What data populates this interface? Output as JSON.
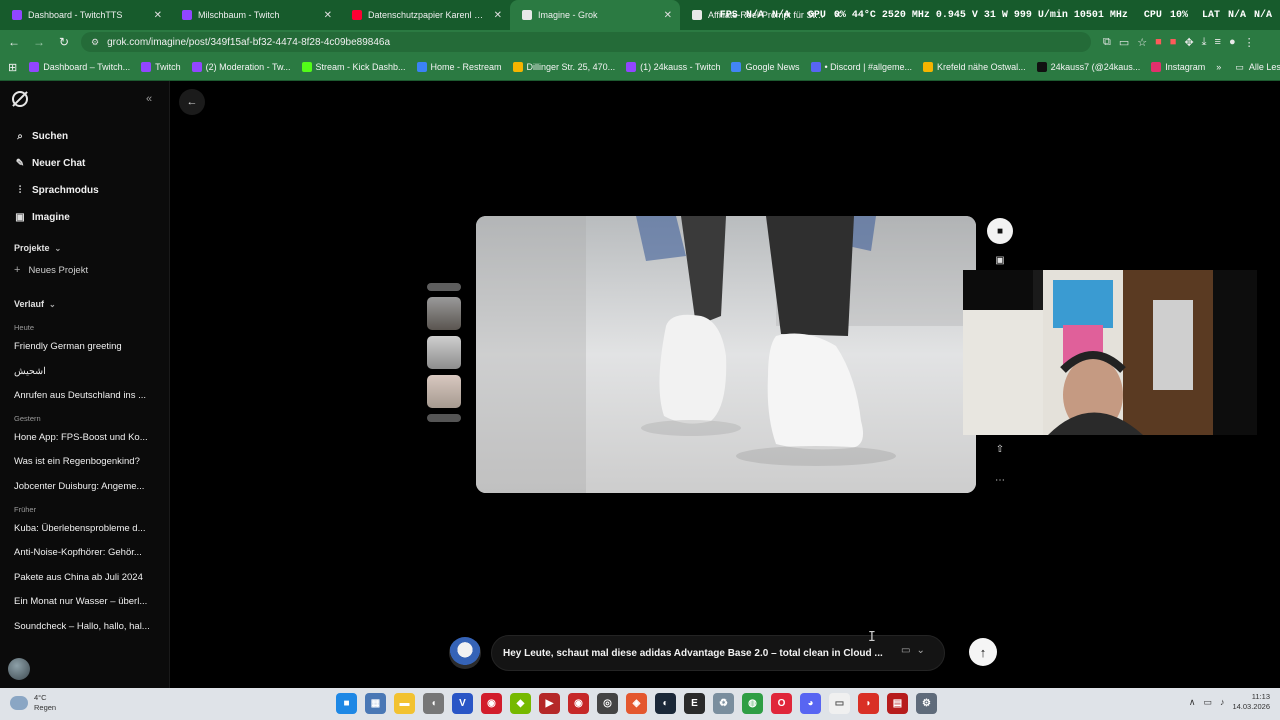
{
  "tabs": [
    {
      "label": "Dashboard - TwitchTTS",
      "color": "#9146ff",
      "active": false
    },
    {
      "label": "Milschbaum - Twitch",
      "color": "#9146ff",
      "active": false
    },
    {
      "label": "Datenschutzpapier Karenl Dein",
      "color": "#ff0033",
      "active": false
    },
    {
      "label": "Imagine - Grok",
      "color": "#e8e8e8",
      "active": true
    },
    {
      "label": "Affiliate-Reel-Prompt für Styling",
      "color": "#e8e8e8",
      "active": false
    }
  ],
  "hud": {
    "fps": "FPS",
    "fps_val": "N/A",
    "fps_val2": "N/A",
    "gpu": "GPU",
    "gpu_stats": "0% 44°C 2520 MHz 0.945 V 31 W 999 U/min 10501 MHz",
    "cpu": "CPU",
    "cpu_val": "10%",
    "lat": "LAT",
    "lat_val": "N/A",
    "lat_val2": "N/A"
  },
  "address": {
    "url": "grok.com/imagine/post/349f15af-bf32-4474-8f28-4c09be89846a"
  },
  "bookmarks": [
    {
      "label": "Dashboard – Twitch...",
      "color": "#9146ff"
    },
    {
      "label": "Twitch",
      "color": "#9146ff"
    },
    {
      "label": "(2) Moderation - Tw...",
      "color": "#9146ff"
    },
    {
      "label": "Stream - Kick Dashb...",
      "color": "#53fc18"
    },
    {
      "label": "Home - Restream",
      "color": "#3b82f6"
    },
    {
      "label": "Dillinger Str. 25, 470...",
      "color": "#f5b400"
    },
    {
      "label": "(1) 24kauss - Twitch",
      "color": "#9146ff"
    },
    {
      "label": "Google News",
      "color": "#4285f4"
    },
    {
      "label": "• Discord | #allgeme...",
      "color": "#5865f2"
    },
    {
      "label": "Krefeld nähe Ostwal...",
      "color": "#f5b400"
    },
    {
      "label": "24kauss7 (@24kaus...",
      "color": "#111111"
    },
    {
      "label": "Instagram",
      "color": "#e1306c"
    }
  ],
  "bookmarks_more": "»",
  "bookmarks_all": "Alle Lesezeichen",
  "sidebar": {
    "menu": [
      {
        "icon": "search-icon",
        "glyph": "⌕",
        "label": "Suchen"
      },
      {
        "icon": "edit-icon",
        "glyph": "✎",
        "label": "Neuer Chat"
      },
      {
        "icon": "voice-icon",
        "glyph": "⫶",
        "label": "Sprachmodus"
      },
      {
        "icon": "image-icon",
        "glyph": "▣",
        "label": "Imagine"
      }
    ],
    "projects_label": "Projekte",
    "new_project": "Neues Projekt",
    "history_label": "Verlauf",
    "groups": [
      {
        "name": "Heute",
        "items": [
          "Friendly German greeting",
          "اشحيش",
          "Anrufen aus Deutschland ins ..."
        ]
      },
      {
        "name": "Gestern",
        "items": [
          "Hone App: FPS-Boost und Ko...",
          "Was ist ein Regenbogenkind?",
          "Jobcenter Duisburg: Angeme..."
        ]
      },
      {
        "name": "Früher",
        "items": [
          "Kuba: Überlebensprobleme d...",
          "Anti-Noise-Kopfhörer: Gehör...",
          "Pakete aus China ab Juli 2024",
          "Ein Monat nur Wasser – überl...",
          "Soundcheck – Hallo, hallo, hal..."
        ]
      }
    ]
  },
  "composer": {
    "text": "Hey Leute, schaut mal diese adidas Advantage Base 2.0 – total clean in Cloud ...",
    "mode_icon": "video-icon"
  },
  "taskbar": {
    "weather_temp": "4°C",
    "weather_desc": "Regen",
    "time": "11:13",
    "date": "14.03.2026",
    "apps": [
      {
        "icon": "windows-start-icon",
        "color": "#1e88e5",
        "glyph": "■"
      },
      {
        "icon": "calculator-icon",
        "color": "#4a78b5",
        "glyph": "▦"
      },
      {
        "icon": "folder-icon",
        "color": "#f2c230",
        "glyph": "▬"
      },
      {
        "icon": "mouse-icon",
        "color": "#777777",
        "glyph": "◖"
      },
      {
        "icon": "vpn-icon",
        "color": "#2a56c6",
        "glyph": "V"
      },
      {
        "icon": "opera-gx-icon",
        "color": "#d21d2b",
        "glyph": "◉"
      },
      {
        "icon": "geforce-icon",
        "color": "#76b900",
        "glyph": "◆"
      },
      {
        "icon": "video-player-icon",
        "color": "#b52828",
        "glyph": "▶"
      },
      {
        "icon": "camera-icon",
        "color": "#c62828",
        "glyph": "◉"
      },
      {
        "icon": "obs-icon",
        "color": "#444444",
        "glyph": "◎"
      },
      {
        "icon": "brave-icon",
        "color": "#e4572e",
        "glyph": "◈"
      },
      {
        "icon": "steam-icon",
        "color": "#1b2838",
        "glyph": "◐"
      },
      {
        "icon": "epic-icon",
        "color": "#2a2a2a",
        "glyph": "E"
      },
      {
        "icon": "recycle-icon",
        "color": "#7a8e9e",
        "glyph": "♻"
      },
      {
        "icon": "chrome-icon",
        "color": "#2f9e44",
        "glyph": "◍"
      },
      {
        "icon": "opera-icon",
        "color": "#e0263a",
        "glyph": "O"
      },
      {
        "icon": "discord-icon",
        "color": "#5865f2",
        "glyph": "◕"
      },
      {
        "icon": "file-icon",
        "color": "#f0f0f0",
        "glyph": "▭"
      },
      {
        "icon": "red-app-icon",
        "color": "#d93025",
        "glyph": "◗"
      },
      {
        "icon": "recorder-icon",
        "color": "#b71c1c",
        "glyph": "▤"
      },
      {
        "icon": "settings-icon",
        "color": "#5f6b7a",
        "glyph": "⚙"
      }
    ]
  }
}
